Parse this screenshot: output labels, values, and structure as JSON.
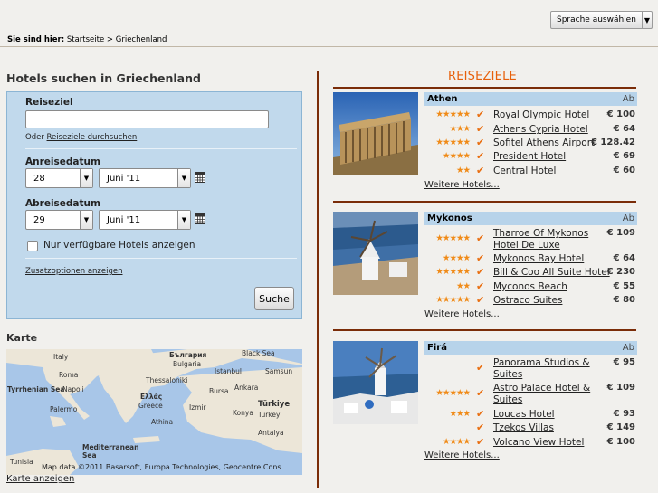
{
  "header": {
    "language_button": "Sprache auswählen"
  },
  "breadcrumb": {
    "prefix": "Sie sind hier:",
    "home": "Startseite",
    "separator": ">",
    "current": "Griechenland"
  },
  "search": {
    "title": "Hotels suchen in Griechenland",
    "destination_label": "Reiseziel",
    "destination_value": "",
    "or_text": "Oder",
    "browse_link": "Reiseziele durchsuchen",
    "arrival_label": "Anreisedatum",
    "arrival_day": "28",
    "arrival_month": "Juni '11",
    "departure_label": "Abreisedatum",
    "departure_day": "29",
    "departure_month": "Juni '11",
    "available_only": "Nur verfügbare Hotels anzeigen",
    "extra_options": "Zusatzoptionen anzeigen",
    "submit": "Suche"
  },
  "map": {
    "title": "Karte",
    "show_link": "Karte anzeigen",
    "credit": "Map data ©2011 Basarsoft, Europa Technologies, Geocentre Cons",
    "labels": [
      "Black Sea",
      "България",
      "Bulgaria",
      "Istanbul",
      "Italy",
      "Roma",
      "Tyrrhenian Sea",
      "Napoli",
      "Palermo",
      "Thessaloniki",
      "Ελλάς",
      "Greece",
      "Athina",
      "Türkiye",
      "Turkey",
      "Ankara",
      "Mediterranean Sea",
      "Tunisia",
      "Bursa",
      "Izmir",
      "Konya",
      "Samsun",
      "Antalya"
    ]
  },
  "destinations_title": "REISEZIELE",
  "destinations": [
    {
      "name": "Athen",
      "price_header": "Ab",
      "hotels": [
        {
          "stars": 5,
          "name": "Royal Olympic Hotel",
          "price": "€ 100"
        },
        {
          "stars": 3,
          "name": "Athens Cypria Hotel",
          "price": "€ 64"
        },
        {
          "stars": 5,
          "name": "Sofitel Athens Airport",
          "price": "€ 128.42"
        },
        {
          "stars": 4,
          "name": "President Hotel",
          "price": "€ 69"
        },
        {
          "stars": 2,
          "name": "Central Hotel",
          "price": "€ 60"
        }
      ],
      "more": "Weitere Hotels..."
    },
    {
      "name": "Mykonos",
      "price_header": "Ab",
      "hotels": [
        {
          "stars": 5,
          "name": "Tharroe Of Mykonos Hotel De Luxe",
          "price": "€ 109"
        },
        {
          "stars": 4,
          "name": "Mykonos Bay Hotel",
          "price": "€ 64"
        },
        {
          "stars": 5,
          "name": "Bill & Coo All Suite Hotel",
          "price": "€ 230"
        },
        {
          "stars": 2,
          "name": "Myconos Beach",
          "price": "€ 55"
        },
        {
          "stars": 5,
          "name": "Ostraco Suites",
          "price": "€ 80"
        }
      ],
      "more": "Weitere Hotels..."
    },
    {
      "name": "Firá",
      "price_header": "Ab",
      "hotels": [
        {
          "stars": 0,
          "name": "Panorama Studios & Suites",
          "price": "€ 95"
        },
        {
          "stars": 5,
          "name": "Astro Palace Hotel & Suites",
          "price": "€ 109"
        },
        {
          "stars": 3,
          "name": "Loucas Hotel",
          "price": "€ 93"
        },
        {
          "stars": 0,
          "name": "Tzekos Villas",
          "price": "€ 149"
        },
        {
          "stars": 4,
          "name": "Volcano View Hotel",
          "price": "€ 100"
        }
      ],
      "more": "Weitere Hotels..."
    }
  ],
  "colors": {
    "accent": "#e7600b",
    "panel": "#c1d9ec",
    "header_row": "#b7d3ea",
    "rule": "#7a2c08",
    "stars": "#f08a17"
  }
}
